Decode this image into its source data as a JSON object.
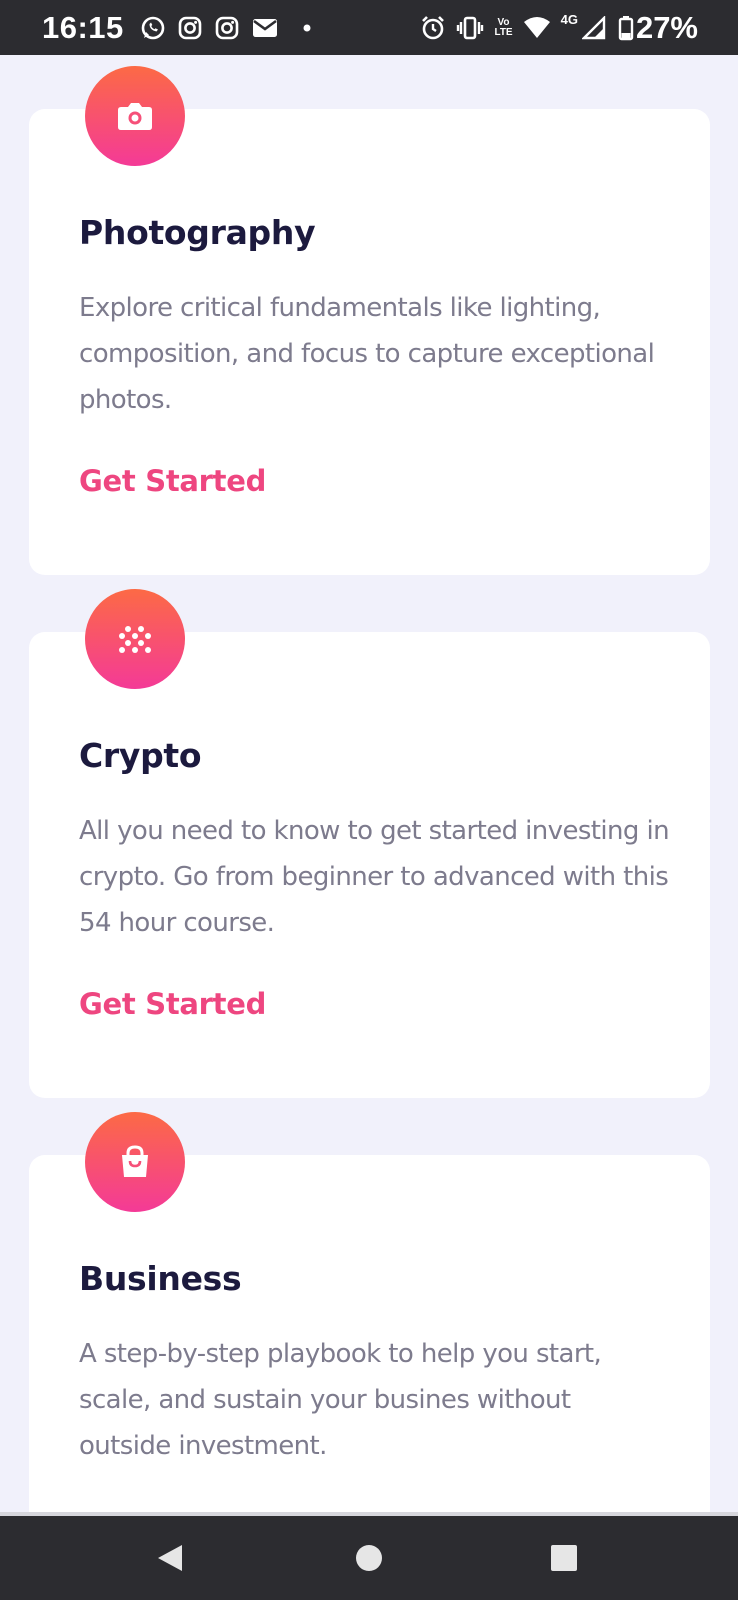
{
  "status_bar": {
    "time": "16:15",
    "battery": "27%",
    "volte_line1": "Vo",
    "volte_line2": "LTE",
    "network": "4G",
    "left_icons": [
      "whatsapp-icon",
      "instagram-icon",
      "instagram-icon",
      "mail-icon",
      "dot-icon"
    ],
    "right_icons": [
      "alarm-icon",
      "vibrate-icon",
      "volte-icon",
      "wifi-icon",
      "signal-icon",
      "battery-icon"
    ]
  },
  "cards": [
    {
      "icon": "camera-icon",
      "title": "Photography",
      "description": "Explore critical fundamentals like lighting, composition, and focus to capture exceptional photos.",
      "cta": "Get Started"
    },
    {
      "icon": "crypto-dots-icon",
      "title": "Crypto",
      "description": "All you need to know to get started investing in crypto. Go from beginner to advanced with this 54 hour course.",
      "cta": "Get Started"
    },
    {
      "icon": "shopping-bag-icon",
      "title": "Business",
      "description": "A step-by-step playbook to help you start, scale, and sustain your busines without outside investment."
    }
  ],
  "colors": {
    "background": "#f1f1fb",
    "card": "#ffffff",
    "title": "#1c1a3e",
    "body_text": "#7d7b8d",
    "accent": "#ee4680",
    "icon_gradient_top": "#fc6a45",
    "icon_gradient_bottom": "#f43a97",
    "system_bar": "#2c2c30"
  },
  "nav_bar": {
    "buttons": [
      "back-icon",
      "home-icon",
      "recents-icon"
    ]
  }
}
